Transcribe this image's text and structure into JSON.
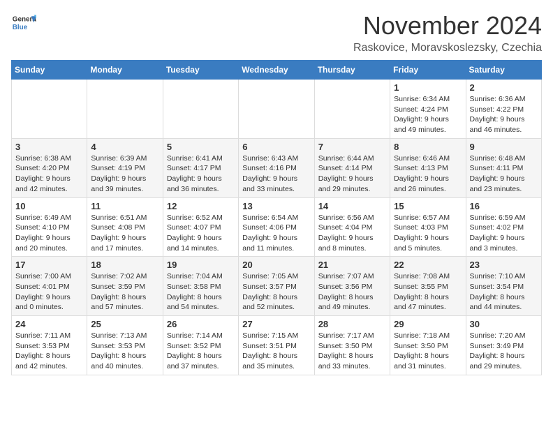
{
  "header": {
    "logo_general": "General",
    "logo_blue": "Blue",
    "month_year": "November 2024",
    "location": "Raskovice, Moravskoslezsky, Czechia"
  },
  "days_of_week": [
    "Sunday",
    "Monday",
    "Tuesday",
    "Wednesday",
    "Thursday",
    "Friday",
    "Saturday"
  ],
  "weeks": [
    [
      {
        "day": "",
        "info": ""
      },
      {
        "day": "",
        "info": ""
      },
      {
        "day": "",
        "info": ""
      },
      {
        "day": "",
        "info": ""
      },
      {
        "day": "",
        "info": ""
      },
      {
        "day": "1",
        "info": "Sunrise: 6:34 AM\nSunset: 4:24 PM\nDaylight: 9 hours\nand 49 minutes."
      },
      {
        "day": "2",
        "info": "Sunrise: 6:36 AM\nSunset: 4:22 PM\nDaylight: 9 hours\nand 46 minutes."
      }
    ],
    [
      {
        "day": "3",
        "info": "Sunrise: 6:38 AM\nSunset: 4:20 PM\nDaylight: 9 hours\nand 42 minutes."
      },
      {
        "day": "4",
        "info": "Sunrise: 6:39 AM\nSunset: 4:19 PM\nDaylight: 9 hours\nand 39 minutes."
      },
      {
        "day": "5",
        "info": "Sunrise: 6:41 AM\nSunset: 4:17 PM\nDaylight: 9 hours\nand 36 minutes."
      },
      {
        "day": "6",
        "info": "Sunrise: 6:43 AM\nSunset: 4:16 PM\nDaylight: 9 hours\nand 33 minutes."
      },
      {
        "day": "7",
        "info": "Sunrise: 6:44 AM\nSunset: 4:14 PM\nDaylight: 9 hours\nand 29 minutes."
      },
      {
        "day": "8",
        "info": "Sunrise: 6:46 AM\nSunset: 4:13 PM\nDaylight: 9 hours\nand 26 minutes."
      },
      {
        "day": "9",
        "info": "Sunrise: 6:48 AM\nSunset: 4:11 PM\nDaylight: 9 hours\nand 23 minutes."
      }
    ],
    [
      {
        "day": "10",
        "info": "Sunrise: 6:49 AM\nSunset: 4:10 PM\nDaylight: 9 hours\nand 20 minutes."
      },
      {
        "day": "11",
        "info": "Sunrise: 6:51 AM\nSunset: 4:08 PM\nDaylight: 9 hours\nand 17 minutes."
      },
      {
        "day": "12",
        "info": "Sunrise: 6:52 AM\nSunset: 4:07 PM\nDaylight: 9 hours\nand 14 minutes."
      },
      {
        "day": "13",
        "info": "Sunrise: 6:54 AM\nSunset: 4:06 PM\nDaylight: 9 hours\nand 11 minutes."
      },
      {
        "day": "14",
        "info": "Sunrise: 6:56 AM\nSunset: 4:04 PM\nDaylight: 9 hours\nand 8 minutes."
      },
      {
        "day": "15",
        "info": "Sunrise: 6:57 AM\nSunset: 4:03 PM\nDaylight: 9 hours\nand 5 minutes."
      },
      {
        "day": "16",
        "info": "Sunrise: 6:59 AM\nSunset: 4:02 PM\nDaylight: 9 hours\nand 3 minutes."
      }
    ],
    [
      {
        "day": "17",
        "info": "Sunrise: 7:00 AM\nSunset: 4:01 PM\nDaylight: 9 hours\nand 0 minutes."
      },
      {
        "day": "18",
        "info": "Sunrise: 7:02 AM\nSunset: 3:59 PM\nDaylight: 8 hours\nand 57 minutes."
      },
      {
        "day": "19",
        "info": "Sunrise: 7:04 AM\nSunset: 3:58 PM\nDaylight: 8 hours\nand 54 minutes."
      },
      {
        "day": "20",
        "info": "Sunrise: 7:05 AM\nSunset: 3:57 PM\nDaylight: 8 hours\nand 52 minutes."
      },
      {
        "day": "21",
        "info": "Sunrise: 7:07 AM\nSunset: 3:56 PM\nDaylight: 8 hours\nand 49 minutes."
      },
      {
        "day": "22",
        "info": "Sunrise: 7:08 AM\nSunset: 3:55 PM\nDaylight: 8 hours\nand 47 minutes."
      },
      {
        "day": "23",
        "info": "Sunrise: 7:10 AM\nSunset: 3:54 PM\nDaylight: 8 hours\nand 44 minutes."
      }
    ],
    [
      {
        "day": "24",
        "info": "Sunrise: 7:11 AM\nSunset: 3:53 PM\nDaylight: 8 hours\nand 42 minutes."
      },
      {
        "day": "25",
        "info": "Sunrise: 7:13 AM\nSunset: 3:53 PM\nDaylight: 8 hours\nand 40 minutes."
      },
      {
        "day": "26",
        "info": "Sunrise: 7:14 AM\nSunset: 3:52 PM\nDaylight: 8 hours\nand 37 minutes."
      },
      {
        "day": "27",
        "info": "Sunrise: 7:15 AM\nSunset: 3:51 PM\nDaylight: 8 hours\nand 35 minutes."
      },
      {
        "day": "28",
        "info": "Sunrise: 7:17 AM\nSunset: 3:50 PM\nDaylight: 8 hours\nand 33 minutes."
      },
      {
        "day": "29",
        "info": "Sunrise: 7:18 AM\nSunset: 3:50 PM\nDaylight: 8 hours\nand 31 minutes."
      },
      {
        "day": "30",
        "info": "Sunrise: 7:20 AM\nSunset: 3:49 PM\nDaylight: 8 hours\nand 29 minutes."
      }
    ]
  ]
}
